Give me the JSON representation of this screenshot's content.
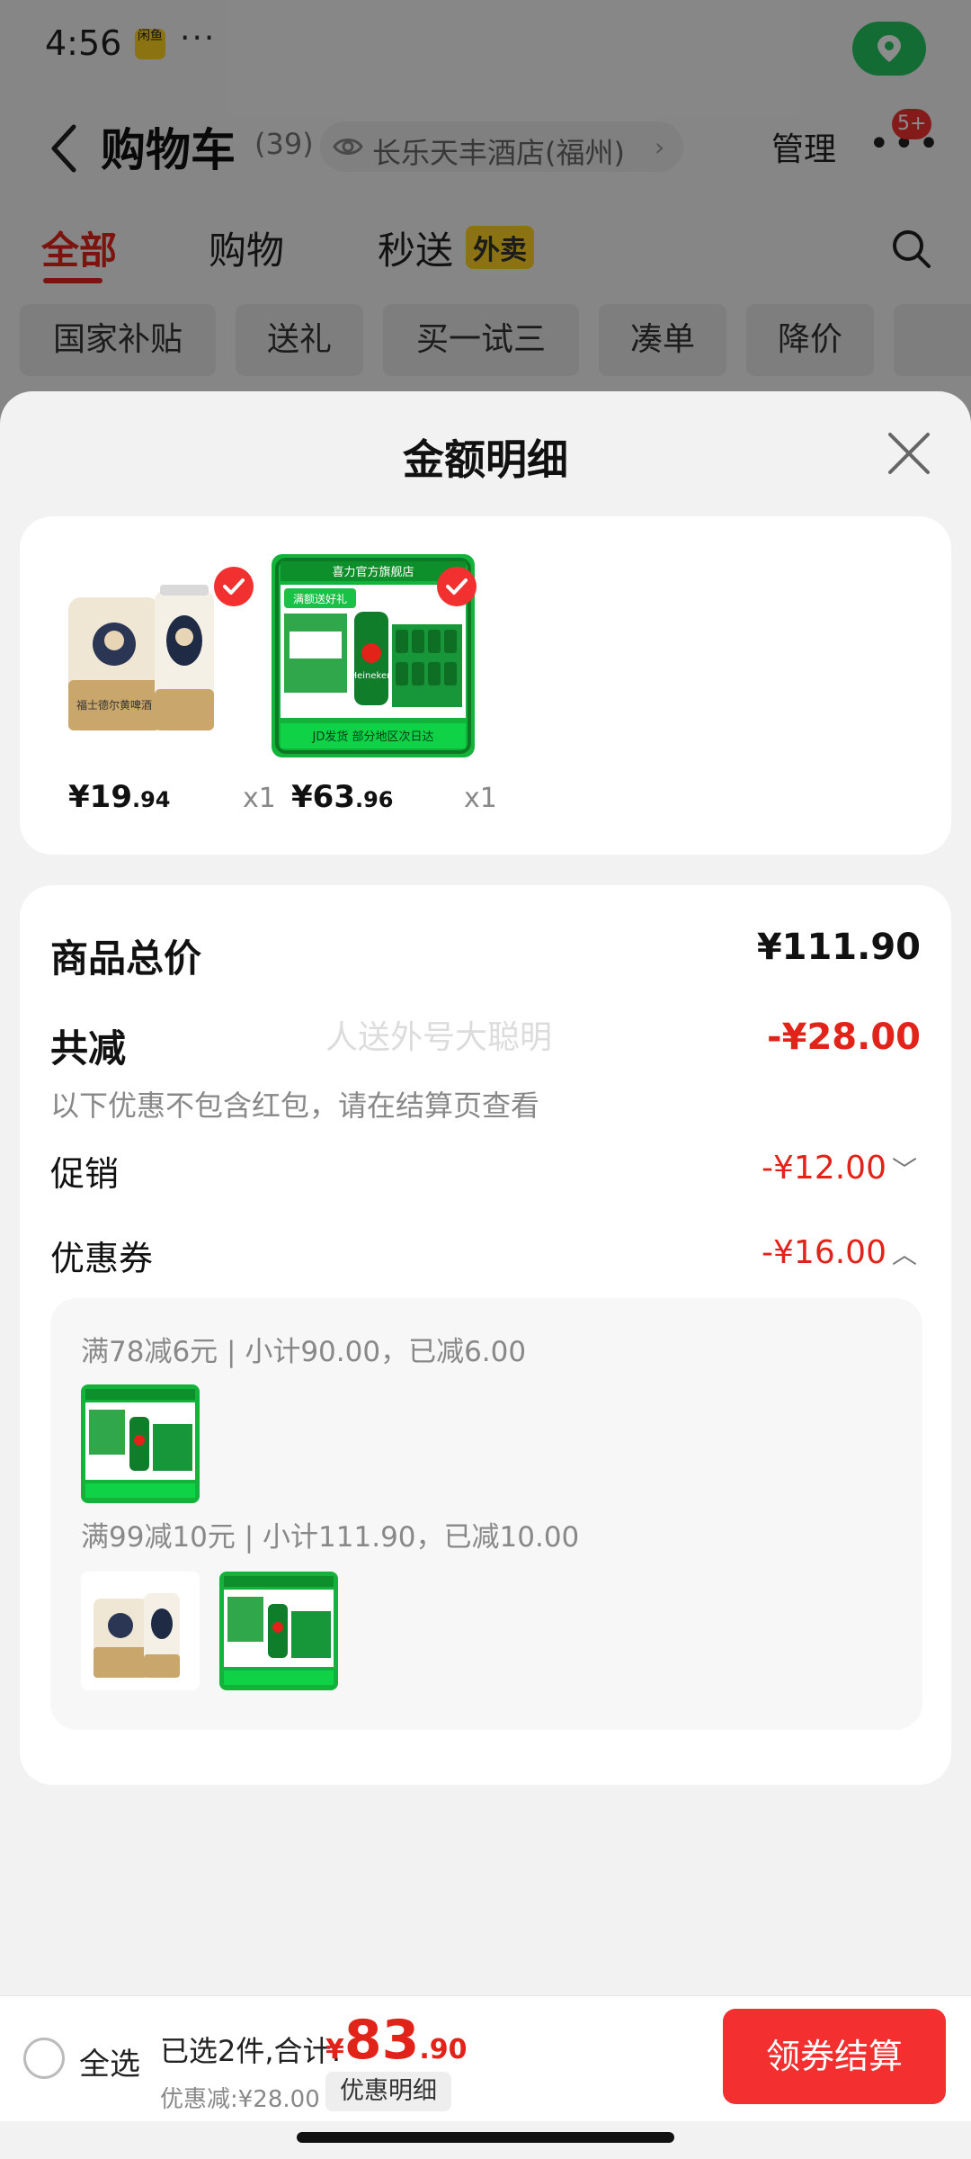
{
  "status_bar": {
    "time": "4:56",
    "app_icon_text": "闲鱼",
    "dots": "···"
  },
  "nav": {
    "title": "购物车",
    "count": "(39)",
    "store": "长乐天丰酒店(福州)",
    "store_chevron": "›",
    "manage": "管理",
    "more_dots": "•••",
    "badge": "5+"
  },
  "tabs": [
    {
      "label": "全部",
      "active": true
    },
    {
      "label": "购物",
      "active": false
    },
    {
      "label": "秒送",
      "active": false
    }
  ],
  "tab_badge": "外卖",
  "chips": [
    "国家补贴",
    "送礼",
    "买一试三",
    "凑单",
    "降价"
  ],
  "sheet": {
    "title": "金额明细",
    "products": [
      {
        "name": "beer-can-pack",
        "price_int": "¥19",
        "price_dec": ".94",
        "qty": "x1"
      },
      {
        "name": "heineken-box",
        "price_int": "¥63",
        "price_dec": ".96",
        "qty": "x1"
      }
    ],
    "product_image_text": {
      "can_label": "福士德尔黄啤酒",
      "brand_bar": "喜力官方旗舰店",
      "promo_banner": "满额送好礼",
      "brand_logo": "Heineken",
      "footer": "JD发货 部分地区次日达"
    },
    "details": {
      "total_label": "商品总价",
      "total_value": "¥111.90",
      "reduce_label": "共减",
      "reduce_value": "-¥28.00",
      "note": "以下优惠不包含红包，请在结算页查看",
      "watermark": "人送外号大聪明",
      "promo_label": "促销",
      "promo_value": "-¥12.00",
      "promo_arrow": "﹀",
      "coupon_label": "优惠券",
      "coupon_value": "-¥16.00",
      "coupon_arrow": "︿"
    },
    "coupons": [
      {
        "text": "满78减6元 | 小计90.00，已减6.00"
      },
      {
        "text": "满99减10元 | 小计111.90，已减10.00"
      }
    ]
  },
  "bottom": {
    "select_all": "全选",
    "selected_text": "已选2件,合计:",
    "total_yen": "¥",
    "total_int": "83",
    "total_dec": ".90",
    "saved": "优惠减:¥28.00",
    "detail_chip": "优惠明细",
    "checkout": "领券结算"
  },
  "colors": {
    "accent_red": "#e2231a",
    "button_red": "#f42f2f",
    "heineken_green": "#1aa33a",
    "location_green": "#23c55e"
  }
}
